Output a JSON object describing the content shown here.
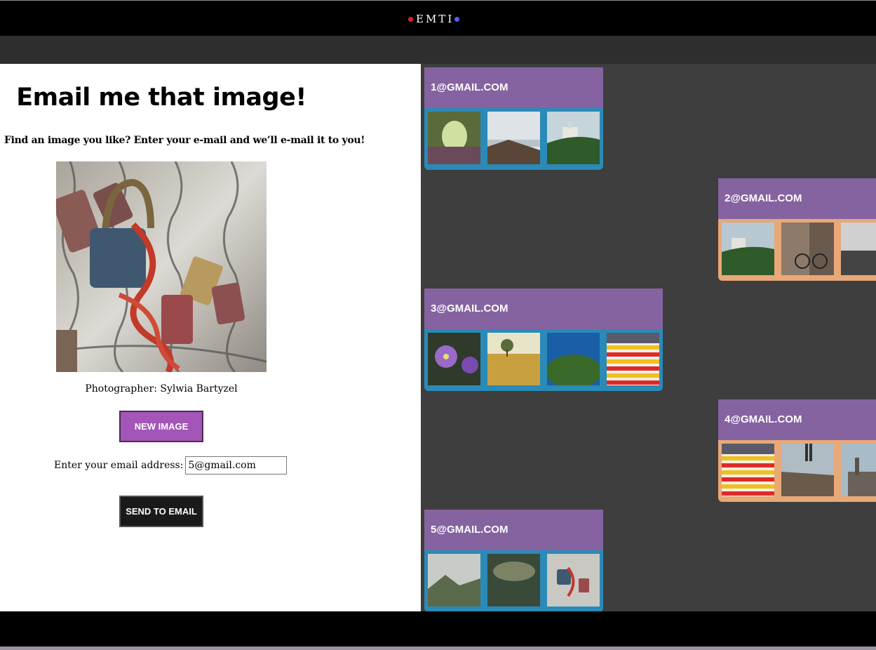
{
  "header": {
    "logo_text": "EMTI"
  },
  "main": {
    "title": "Email me that image!",
    "subtitle": "Find an image you like? Enter your e-mail and we’ll e-mail it to you!",
    "image_icon": "padlocks-on-fence-photo",
    "credit": "Photographer: Sylwia Bartyzel",
    "new_image_label": "NEW IMAGE",
    "email_label": "Enter your email address:",
    "email_value": "5@gmail.com",
    "send_label": "SEND TO EMAIL"
  },
  "colors": {
    "accent_purple": "#8563a0",
    "button_purple": "#a455b8",
    "card_blue": "#2a8ab8",
    "card_tan": "#e8a877"
  },
  "cards": [
    {
      "email": "1@GMAIL.COM",
      "color": "blue",
      "thumbs": [
        "forest-tunnel",
        "rocky-coast",
        "castle-hill"
      ]
    },
    {
      "email": "2@GMAIL.COM",
      "color": "tan",
      "thumbs": [
        "castle-hill",
        "street-bicycle",
        "misty-sea"
      ]
    },
    {
      "email": "3@GMAIL.COM",
      "color": "blue",
      "thumbs": [
        "purple-flowers",
        "lone-tree-field",
        "green-island",
        "striped-building"
      ]
    },
    {
      "email": "4@GMAIL.COM",
      "color": "tan",
      "thumbs": [
        "striped-building",
        "person-on-rocks",
        "industrial-plant"
      ]
    },
    {
      "email": "5@GMAIL.COM",
      "color": "blue",
      "thumbs": [
        "misty-mountain",
        "foggy-forest",
        "padlocks-on-fence"
      ]
    }
  ]
}
